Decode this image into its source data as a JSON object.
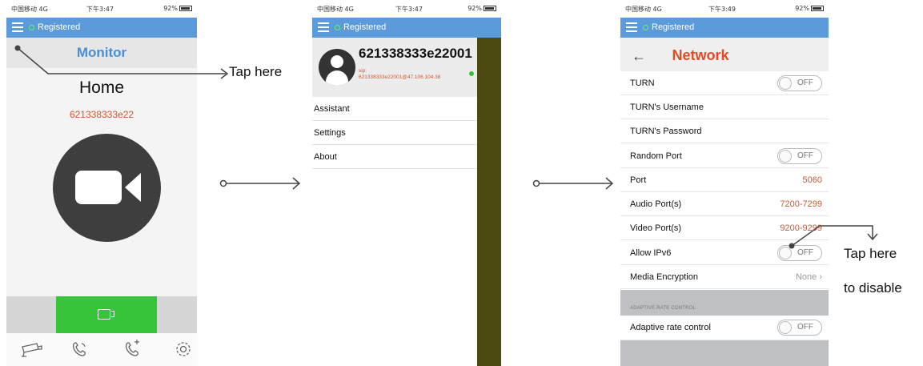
{
  "status": {
    "carrier": "中国移动 4G",
    "battery": "92%",
    "times": [
      "下午3:47",
      "下午3:47",
      "下午3:49"
    ]
  },
  "topbar": {
    "registered": "Registered"
  },
  "monitor": {
    "header": "Monitor",
    "title": "Home",
    "device_id": "621338333e22"
  },
  "drawer": {
    "account": "621338333e22001",
    "sip_line1": "sip:",
    "sip_line2": "621338333e22001@47.106.104.38",
    "items": [
      "Assistant",
      "Settings",
      "About"
    ]
  },
  "network": {
    "title": "Network",
    "rows": [
      {
        "label": "TURN",
        "toggle": "OFF"
      },
      {
        "label": "TURN's Username"
      },
      {
        "label": "TURN's Password"
      },
      {
        "label": "Random Port",
        "toggle": "OFF"
      },
      {
        "label": "Port",
        "value": "5060"
      },
      {
        "label": "Audio Port(s)",
        "value": "7200-7299"
      },
      {
        "label": "Video Port(s)",
        "value": "9200-9299"
      },
      {
        "label": "Allow IPv6",
        "toggle": "OFF"
      },
      {
        "label": "Media Encryption",
        "value": "None ›"
      }
    ],
    "section_header": "ADAPTIVE RATE CONTROL",
    "adaptive": {
      "label": "Adaptive rate control",
      "toggle": "OFF"
    }
  },
  "annotations": {
    "tap_here": "Tap here",
    "tap_here_2": "Tap here",
    "to_disable": "to disable"
  },
  "colors": {
    "topbar": "#5b9bdc",
    "accent_red": "#e84a24",
    "green": "#37c43b",
    "drawer_overlay": "#4c4a10"
  }
}
